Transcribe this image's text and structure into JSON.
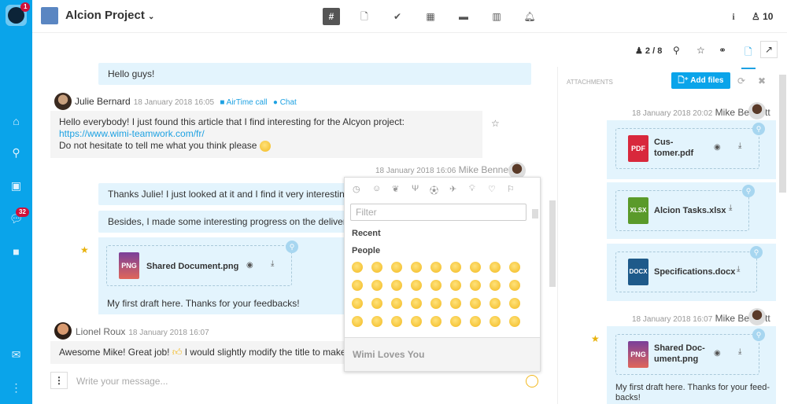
{
  "sidebar": {
    "logo_badge": "1",
    "chat_badge": "32",
    "items": [
      "home-icon",
      "search-icon",
      "contacts-icon",
      "chat-icon",
      "video-icon",
      "mail-icon",
      "more-icon"
    ]
  },
  "header": {
    "project": "Alcion Project",
    "tabs": [
      "#",
      "files",
      "tasks",
      "calendar",
      "briefcase",
      "stats",
      "notifications"
    ],
    "info": "i",
    "members": "10"
  },
  "toolbar": {
    "presence": "2 / 8"
  },
  "chat": {
    "messages": [
      {
        "text": "Hello guys!"
      },
      {
        "author": "Julie Bernard",
        "date": "18 January 2018 16:05",
        "airtime": "AirTime call",
        "chat": "Chat",
        "lines": [
          "Hello everybody! I just found this article that I find interesting for the Alcyon project:",
          "https://www.wimi-teamwork.com/fr/",
          "Do not hesitate to tell me what you think please"
        ]
      },
      {
        "author": "Mike Bennett",
        "date": "18 January 2018 16:06"
      },
      {
        "text": "Thanks Julie! I just looked at it and I find it very interesting. Do you"
      },
      {
        "text": "Besides, I made some interesting progress on the deliverable of"
      },
      {
        "file": "Shared Document.png",
        "ext": "PNG",
        "caption": "My first draft here. Thanks for your feedbacks!"
      },
      {
        "author": "Lionel Roux",
        "date": "18 January 2018 16:07",
        "text": "Awesome Mike!  Great job!",
        "text2": "I would slightly modify the title to make it a li"
      }
    ],
    "input_placeholder": "Write your message..."
  },
  "picker": {
    "filter_placeholder": "Filter",
    "recent": "Recent",
    "people": "People",
    "footer": "Wimi Loves You"
  },
  "attachments": {
    "title": "ATTACHMENTS",
    "add": "Add files",
    "groups": [
      {
        "date": "18 January 2018 20:02",
        "author": "Mike Bennett",
        "files": [
          {
            "ext": "PDF",
            "name1": "Cus-",
            "name2": "tomer.pdf"
          },
          {
            "ext": "XLSX",
            "name1": "Alcion Tasks.xlsx"
          },
          {
            "ext": "DOCX",
            "name1": "Specifications.docx"
          }
        ]
      },
      {
        "date": "18 January 2018 16:07",
        "author": "Mike Bennett",
        "files": [
          {
            "ext": "PNG",
            "name1": "Shared Doc-",
            "name2": "ument.png"
          }
        ],
        "caption1": "My first draft here. Thanks for your feed-",
        "caption2": "backs!"
      }
    ]
  },
  "colors": {
    "brand": "#0aa4ea",
    "bubble": "#e3f4fd",
    "badge": "#d0103a"
  }
}
